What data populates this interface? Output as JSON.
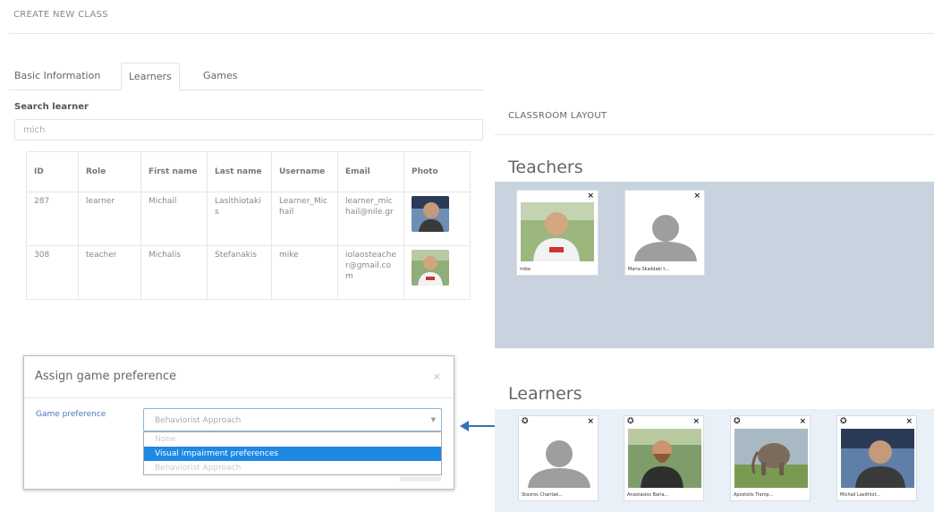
{
  "page": {
    "title": "CREATE NEW CLASS"
  },
  "tabs": [
    "Basic Information",
    "Learners",
    "Games"
  ],
  "search": {
    "label": "Search learner",
    "value": "mich"
  },
  "table": {
    "headers": [
      "ID",
      "Role",
      "First name",
      "Last name",
      "Username",
      "Email",
      "Photo"
    ],
    "rows": [
      {
        "id": "287",
        "role": "learner",
        "first": "Michail",
        "last": "Lasithiotakis",
        "username": "Learner_Michail",
        "email": "learner_michail@nile.gr"
      },
      {
        "id": "308",
        "role": "teacher",
        "first": "Michalis",
        "last": "Stefanakis",
        "username": "mike",
        "email": "iolaosteacher@gmail.com"
      }
    ]
  },
  "modal": {
    "title": "Assign game preference",
    "close": "×",
    "label": "Game preference",
    "selected": "Behaviorist Approach",
    "options": [
      "None",
      "Visual impairment preferences",
      "Behaviorist Approach"
    ],
    "highlighted_option": "Visual impairment preferences"
  },
  "layout": {
    "title": "CLASSROOM LAYOUT",
    "teachers_heading": "Teachers",
    "learners_heading": "Learners",
    "teachers": [
      {
        "name": "mike",
        "avatar": "photo"
      },
      {
        "name": "Maria Skalidaki t...",
        "avatar": "placeholder"
      }
    ],
    "learners": [
      {
        "name": "Stavros Charitak...",
        "avatar": "placeholder"
      },
      {
        "name": "Anastasios Baria...",
        "avatar": "photo"
      },
      {
        "name": "Apostolis Tramp...",
        "avatar": "photo"
      },
      {
        "name": "Michail Lasithiot...",
        "avatar": "photo"
      }
    ]
  },
  "icons": {
    "close": "×",
    "gear": "gear-icon",
    "dropdown": "chevron-down-icon",
    "arrow": "double-arrow-icon"
  },
  "colors": {
    "teachers_bg": "#c9d3df",
    "learners_bg": "#e9f0f8",
    "accent": "#1e88e5",
    "label_blue": "#4a78b8"
  }
}
